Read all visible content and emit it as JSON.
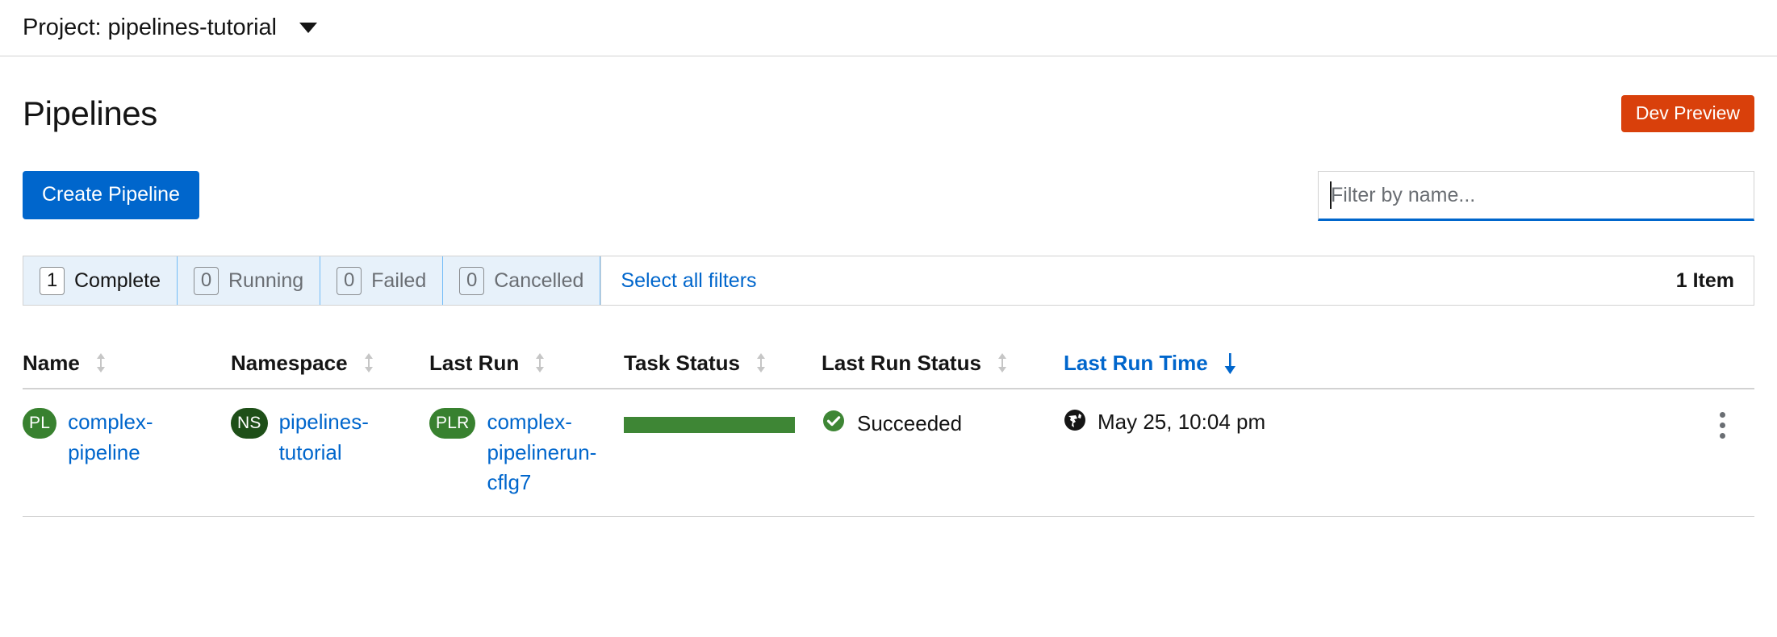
{
  "project_bar": {
    "label": "Project: pipelines-tutorial",
    "caret_icon": "chevron-down-icon"
  },
  "header": {
    "title": "Pipelines",
    "dev_preview_badge": "Dev Preview",
    "dev_preview_color": "#d9400b"
  },
  "toolbar": {
    "create_button": "Create Pipeline",
    "create_button_color": "#0066cc",
    "filter_placeholder": "Filter by name...",
    "filter_value": ""
  },
  "filter_bar": {
    "toggles": [
      {
        "count": "1",
        "label": "Complete",
        "active": true
      },
      {
        "count": "0",
        "label": "Running",
        "active": false
      },
      {
        "count": "0",
        "label": "Failed",
        "active": false
      },
      {
        "count": "0",
        "label": "Cancelled",
        "active": false
      }
    ],
    "select_all_filters": "Select all filters",
    "item_count": "1 Item"
  },
  "table": {
    "columns": [
      {
        "label": "Name",
        "sort": "none"
      },
      {
        "label": "Namespace",
        "sort": "none"
      },
      {
        "label": "Last Run",
        "sort": "none"
      },
      {
        "label": "Task Status",
        "sort": "none"
      },
      {
        "label": "Last Run Status",
        "sort": "none"
      },
      {
        "label": "Last Run Time",
        "sort": "desc"
      }
    ],
    "rows": [
      {
        "name_badge": "PL",
        "name": "complex-pipeline",
        "namespace_badge": "NS",
        "namespace": "pipelines-tutorial",
        "last_run_badge": "PLR",
        "last_run": "complex-pipelinerun-cflg7",
        "task_status_color": "#3e8635",
        "last_run_status": "Succeeded",
        "last_run_status_icon": "check-circle-icon",
        "last_run_time": "May 25, 10:04 pm",
        "last_run_time_icon": "globe-icon",
        "kebab_icon": "kebab-menu-icon"
      }
    ]
  }
}
